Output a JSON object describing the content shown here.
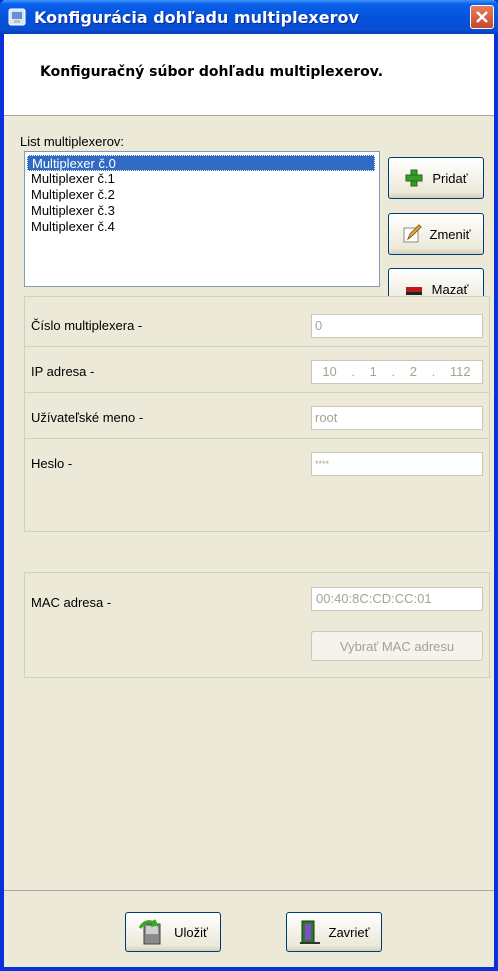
{
  "window": {
    "title": "Konfigurácia dohľadu multiplexerov",
    "subtitle": "Konfiguračný súbor dohľadu multiplexerov."
  },
  "list": {
    "label": "List multiplexerov:",
    "items": [
      "Multiplexer č.0",
      "Multiplexer č.1",
      "Multiplexer č.2",
      "Multiplexer č.3",
      "Multiplexer č.4"
    ],
    "selected_index": 0
  },
  "buttons": {
    "add": "Pridať",
    "edit": "Zmeniť",
    "delete": "Mazať",
    "select_mac": "Vybrať MAC adresu",
    "save": "Uložiť",
    "close": "Zavrieť"
  },
  "fields": {
    "number_label": "Číslo multiplexera -",
    "number_value": "0",
    "ip_label": "IP adresa -",
    "ip_octets": [
      "10",
      "1",
      "2",
      "112"
    ],
    "user_label": "Užívateľské meno -",
    "user_value": "root",
    "password_label": "Heslo -",
    "password_value": "****",
    "mac_label": "MAC adresa -",
    "mac_value": "00:40:8C:CD:CC:01"
  },
  "colors": {
    "titlebar": "#0a5fe9",
    "selection": "#316ac5",
    "window_bg": "#ece9d8"
  },
  "icons": {
    "app": "app-icon",
    "close": "close-x-icon",
    "add": "green-plus-icon",
    "edit": "pencil-icon",
    "delete": "red-minus-icon",
    "save": "save-arrow-icon",
    "exit": "door-exit-icon"
  }
}
